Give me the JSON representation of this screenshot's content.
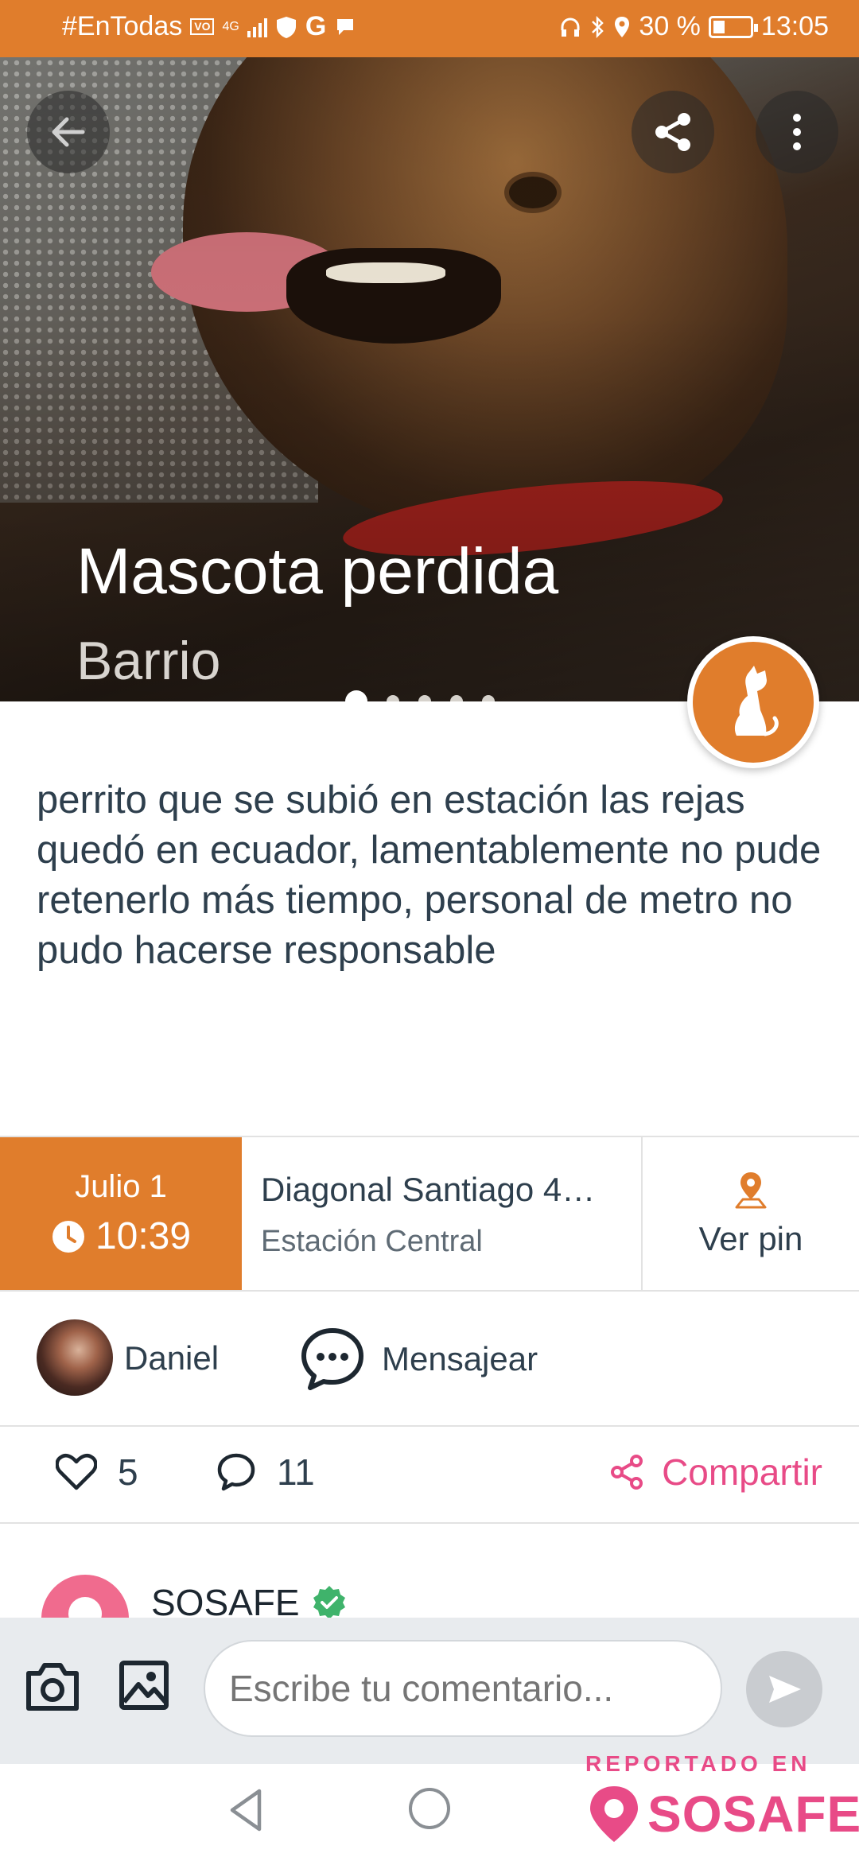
{
  "status_bar": {
    "carrier": "#EnTodas",
    "network": "4G",
    "battery": "30 %",
    "time": "13:05"
  },
  "hero": {
    "title": "Mascota perdida",
    "subtitle": "Barrio",
    "slide_count": 5,
    "active_slide": 1
  },
  "post": {
    "description": "perrito que se subió en estación las rejas quedó en ecuador, lamentablemente no pude retenerlo más tiempo, personal de metro no pudo hacerse responsable"
  },
  "info": {
    "date": "Julio 1",
    "time": "10:39",
    "address_line1": "Diagonal Santiago  4…",
    "address_line2": "Estación Central",
    "pin_label": "Ver pin"
  },
  "user": {
    "name": "Daniel",
    "message_label": "Mensajear"
  },
  "stats": {
    "likes": "5",
    "comments": "11",
    "share_label": "Compartir"
  },
  "community": {
    "name": "SOSAFE"
  },
  "comment_bar": {
    "placeholder": "Escribe tu comentario..."
  },
  "watermark": {
    "top": "REPORTADO EN",
    "brand": "SOSAFE"
  },
  "colors": {
    "brand_orange": "#e07d2c",
    "accent_pink": "#e84b87",
    "verified_green": "#3fb36b"
  }
}
